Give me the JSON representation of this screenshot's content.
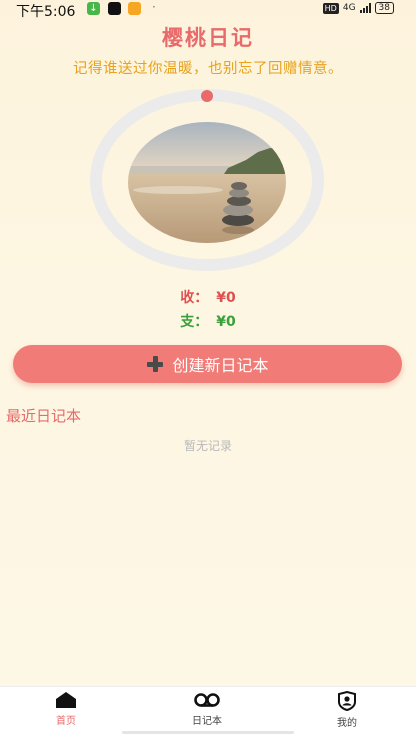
{
  "status_bar": {
    "time": "下午5:06",
    "network": "4G",
    "battery": "38",
    "hd_badge": "HD"
  },
  "header": {
    "title": "樱桃日记",
    "subtitle": "记得谁送过你温暖，也别忘了回赠情意。"
  },
  "summary": {
    "income_label": "收：",
    "income_value": "¥0",
    "expense_label": "支：",
    "expense_value": "¥0"
  },
  "create_button": {
    "label": "创建新日记本"
  },
  "recent": {
    "title": "最近日记本",
    "empty_text": "暂无记录"
  },
  "tabbar": {
    "items": [
      {
        "label": "首页",
        "icon": "home-icon",
        "active": true
      },
      {
        "label": "日记本",
        "icon": "tape-icon",
        "active": false
      },
      {
        "label": "我的",
        "icon": "profile-icon",
        "active": false
      }
    ]
  },
  "colors": {
    "accent": "#e86a6a",
    "subtitle": "#e8a21e",
    "button": "#f17b76",
    "income": "#e05050",
    "expense": "#3aa03a",
    "background": "#fdf5e0"
  }
}
